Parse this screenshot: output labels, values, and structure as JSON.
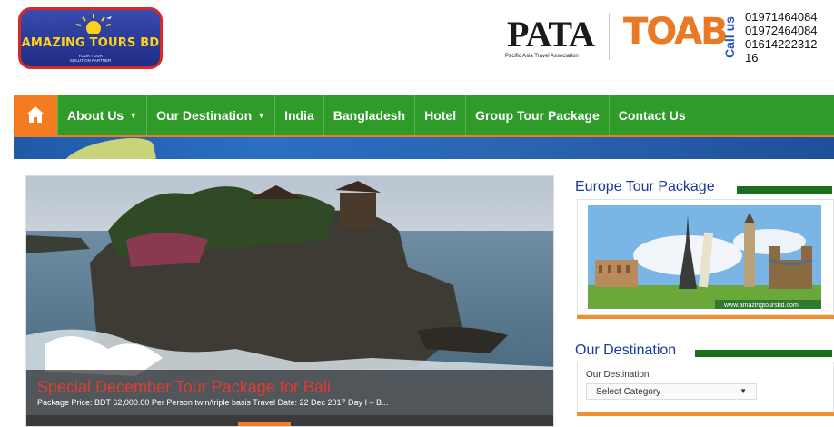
{
  "logo": {
    "name": "AMAZING TOURS BD",
    "tagline_1": "YOUR TOUR",
    "tagline_2": "SOLUTION PARTNER"
  },
  "partners": {
    "pata_word": "PATA",
    "pata_sub": "Pacific Asia Travel Association",
    "toab_word": "TOAB"
  },
  "contact": {
    "call_label": "Call us",
    "phones": [
      "01971464084",
      "01972464084",
      "01614222312-16"
    ]
  },
  "nav": {
    "items": [
      {
        "label": "About Us",
        "dropdown": true
      },
      {
        "label": "Our Destination",
        "dropdown": true
      },
      {
        "label": "India",
        "dropdown": false
      },
      {
        "label": "Bangladesh",
        "dropdown": false
      },
      {
        "label": "Hotel",
        "dropdown": false
      },
      {
        "label": "Group Tour Package",
        "dropdown": false
      },
      {
        "label": "Contact Us",
        "dropdown": false
      }
    ]
  },
  "slider": {
    "title": "Special December Tour Package for Bali",
    "description": "Package Price: BDT 62,000.00 Per Person twin/triple basis Travel Date: 22 Dec 2017 Day I  – B..."
  },
  "sidebar": {
    "europe_title": "Europe Tour Package",
    "europe_url": "www.amazingtoursbd.com",
    "dest_title": "Our Destination",
    "dest_label": "Our Destination",
    "dest_select": "Select Category"
  },
  "colors": {
    "nav_green": "#2f9b28",
    "accent_orange": "#f57b20",
    "title_red": "#e53a2e",
    "heading_blue": "#1a3aa0"
  }
}
